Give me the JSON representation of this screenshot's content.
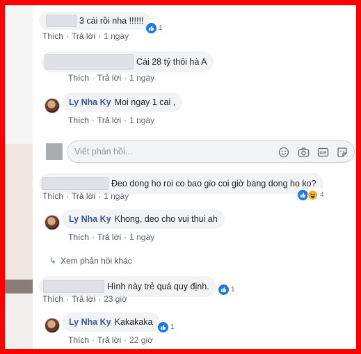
{
  "actions": {
    "like": "Thích",
    "reply": "Trả lời",
    "sep": "·"
  },
  "comments": [
    {
      "text": "3 cái rồi nha !!!!!!",
      "time": "1 ngày",
      "reactions": "1"
    },
    {
      "text": "Cái 28 tỷ thôi hà A",
      "time": "1 ngày"
    },
    {
      "author": "Ly Nha Ky",
      "text": "Moi ngay 1 cai ,",
      "time": "1 ngày"
    },
    {
      "text": "Đeo dong ho roi co bao gio coi giờ bang dong ho ko?",
      "time": "1 ngày",
      "reactions": "4"
    },
    {
      "author": "Ly Nha Ky",
      "text": "Khong, deo cho vui thui ah",
      "time": "1 ngày"
    },
    {
      "text": "Hình này trẻ quá quy định.",
      "time": "23 giờ",
      "reactions": "1"
    },
    {
      "author": "Ly Nha Ky",
      "text": "Kakakaka",
      "time": "22 giờ",
      "reactions": "1"
    }
  ],
  "composer": {
    "placeholder": "Viết phản hồi..."
  },
  "composer_icons": [
    "smiley-icon",
    "camera-icon",
    "gif-icon",
    "sticker-icon"
  ],
  "more_replies": {
    "label": "Xem phản hồi khác"
  },
  "colors": {
    "frame": "#ff0000",
    "link": "#385898",
    "bubble": "#f2f3f5",
    "like": "#1877f2"
  }
}
